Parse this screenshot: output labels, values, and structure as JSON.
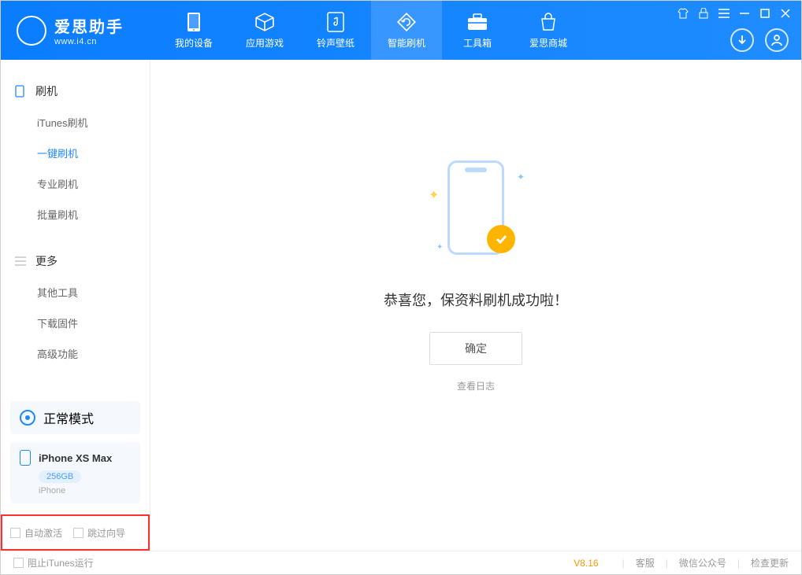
{
  "app": {
    "title": "爱思助手",
    "subtitle": "www.i4.cn"
  },
  "nav": {
    "items": [
      {
        "label": "我的设备"
      },
      {
        "label": "应用游戏"
      },
      {
        "label": "铃声壁纸"
      },
      {
        "label": "智能刷机"
      },
      {
        "label": "工具箱"
      },
      {
        "label": "爱思商城"
      }
    ]
  },
  "sidebar": {
    "sections": [
      {
        "title": "刷机",
        "items": [
          "iTunes刷机",
          "一键刷机",
          "专业刷机",
          "批量刷机"
        ]
      },
      {
        "title": "更多",
        "items": [
          "其他工具",
          "下载固件",
          "高级功能"
        ]
      }
    ]
  },
  "device": {
    "mode": "正常模式",
    "name": "iPhone XS Max",
    "capacity": "256GB",
    "type": "iPhone"
  },
  "options": {
    "autoActivate": "自动激活",
    "skipGuide": "跳过向导"
  },
  "main": {
    "successMsg": "恭喜您，保资料刷机成功啦！",
    "okBtn": "确定",
    "viewLog": "查看日志"
  },
  "footer": {
    "blockItunes": "阻止iTunes运行",
    "version": "V8.16",
    "support": "客服",
    "wechat": "微信公众号",
    "checkUpdate": "检查更新"
  }
}
